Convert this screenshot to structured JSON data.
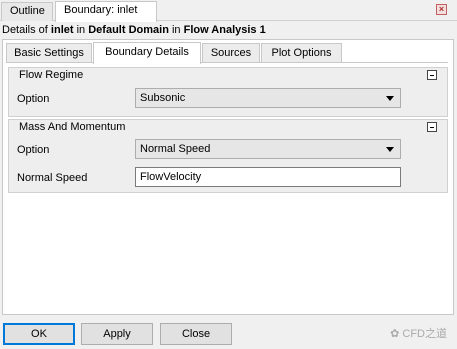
{
  "top_tabs": [
    {
      "label": "Outline"
    },
    {
      "label": "Boundary: inlet"
    }
  ],
  "details": {
    "prefix": "Details of ",
    "object": "inlet",
    "in1": " in ",
    "domain": "Default Domain",
    "in2": " in ",
    "analysis": "Flow Analysis 1"
  },
  "sub_tabs": [
    {
      "label": "Basic Settings"
    },
    {
      "label": "Boundary Details"
    },
    {
      "label": "Sources"
    },
    {
      "label": "Plot Options"
    }
  ],
  "flow_regime": {
    "title": "Flow Regime",
    "option_label": "Option",
    "option_value": "Subsonic"
  },
  "mass_momentum": {
    "title": "Mass And Momentum",
    "option_label": "Option",
    "option_value": "Normal Speed",
    "speed_label": "Normal Speed",
    "speed_value": "FlowVelocity"
  },
  "buttons": {
    "ok": "OK",
    "apply": "Apply",
    "close": "Close"
  },
  "watermark": "CFD之道"
}
